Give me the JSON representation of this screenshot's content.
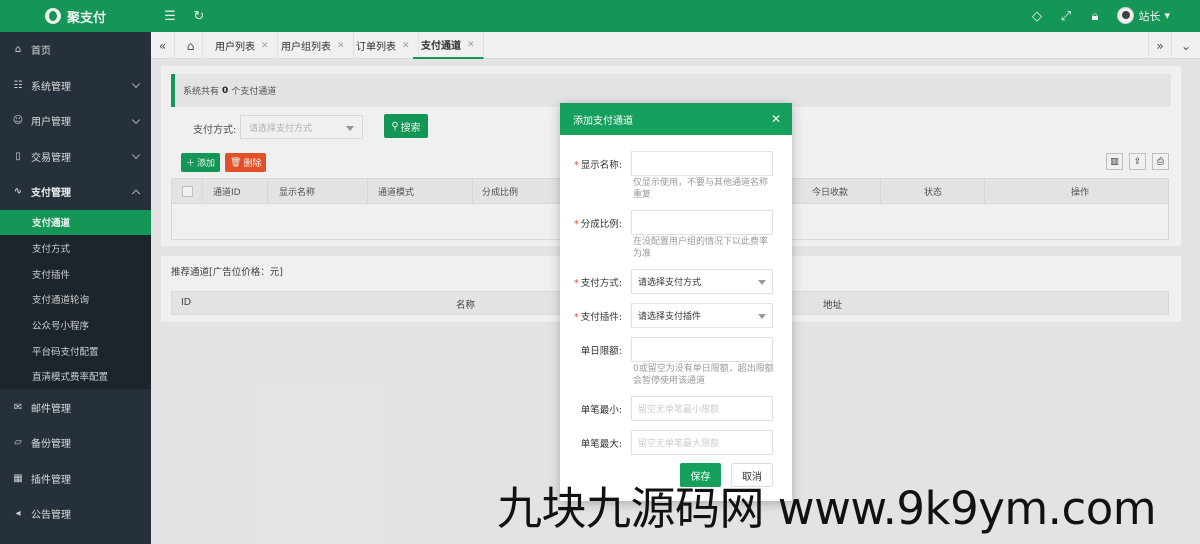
{
  "app": {
    "logo_text": "聚支付",
    "user_name": "站长"
  },
  "colors": {
    "brand": "#16a05d",
    "sidebar": "#28333e",
    "danger": "#f0562a",
    "required": "#e74c3c"
  },
  "topbar": {
    "left_icons": [
      "menu-fold-icon",
      "refresh-icon"
    ],
    "right_icons": [
      "tag-icon",
      "fullscreen-icon",
      "lock-icon"
    ]
  },
  "sidebar": {
    "home": "首页",
    "system": "系统管理",
    "users": "用户管理",
    "trade": "交易管理",
    "payment": "支付管理",
    "payment_sub": [
      "支付通道",
      "支付方式",
      "支付插件",
      "支付通道轮询",
      "公众号小程序",
      "平台码支付配置",
      "直清模式费率配置"
    ],
    "mail": "邮件管理",
    "backup": "备份管理",
    "plugins": "插件管理",
    "notice": "公告管理"
  },
  "tabs": [
    {
      "label": "用户列表"
    },
    {
      "label": "用户组列表"
    },
    {
      "label": "订单列表"
    },
    {
      "label": "支付通道",
      "active": true
    }
  ],
  "main": {
    "notice_prefix": "系统共有",
    "notice_count": "0",
    "notice_suffix": "个支付通道",
    "filter_label": "支付方式:",
    "filter_placeholder": "请选择支付方式",
    "search_button": "搜索",
    "add_button": "添加",
    "delete_button": "删除",
    "columns": [
      "通道ID",
      "显示名称",
      "通道模式",
      "分成比例",
      "今日收款",
      "状态",
      "操作"
    ]
  },
  "recommend": {
    "title": "推荐通道[广告位价格：元]",
    "columns": [
      "ID",
      "名称",
      "地址"
    ]
  },
  "modal": {
    "title": "添加支付通道",
    "fields": {
      "display_name": {
        "label": "显示名称:",
        "hint": "仅显示使用，不要与其他通道名称重复"
      },
      "ratio": {
        "label": "分成比例:",
        "hint": "在没配置用户组的情况下以此费率为准"
      },
      "pay_type": {
        "label": "支付方式:",
        "value": "请选择支付方式"
      },
      "pay_plugin": {
        "label": "支付插件:",
        "value": "请选择支付插件"
      },
      "daily_limit": {
        "label": "单日限额:",
        "hint": "0或留空为没有单日限额，超出限额会暂停使用该通道"
      },
      "min_amount": {
        "label": "单笔最小:",
        "placeholder": "留空无单笔最小限额"
      },
      "max_amount": {
        "label": "单笔最大:",
        "placeholder": "留空无单笔最大限额"
      }
    },
    "save_button": "保存",
    "cancel_button": "取消"
  },
  "watermark": "九块九源码网 www.9k9ym.com"
}
